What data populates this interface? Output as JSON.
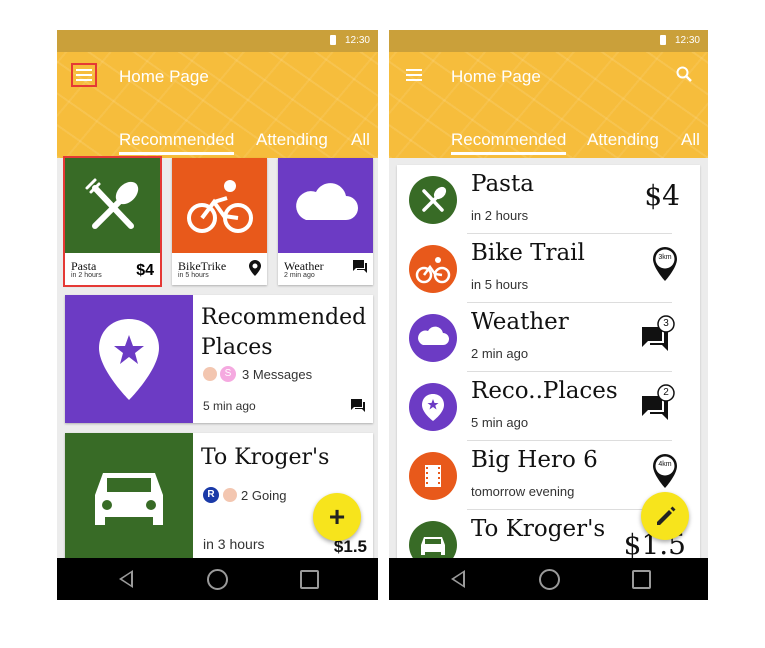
{
  "colors": {
    "appbar": "#f6bd3c",
    "green": "#386b26",
    "orange": "#e8591b",
    "purple": "#6c3bc4",
    "fab": "#f7e41c",
    "highlight": "#e53935"
  },
  "left": {
    "time": "12:30",
    "title": "Home Page",
    "tabs": [
      "Recommended",
      "Attending",
      "All"
    ],
    "cards": [
      {
        "title": "Pasta",
        "sub": "in 2 hours",
        "right": "$4",
        "icon": "fork-spoon-icon"
      },
      {
        "title": "BikeTrike",
        "sub": "in 5 hours",
        "icon": "bike-icon"
      },
      {
        "title": "Weather",
        "sub": "2 min ago",
        "icon": "cloud-icon"
      }
    ],
    "recommended": {
      "title_l1": "Recommended",
      "title_l2": "Places",
      "avatar_letter": "S",
      "messages": "3 Messages",
      "time": "5 min ago"
    },
    "kroger": {
      "title": "To Kroger's",
      "avatar_letter": "R",
      "going": "2 Going",
      "time": "in 3 hours",
      "price": "$1.5"
    },
    "fab_label": "+"
  },
  "right": {
    "time": "12:30",
    "title": "Home Page",
    "tabs": [
      "Recommended",
      "Attending",
      "All"
    ],
    "rows": [
      {
        "title": "Pasta",
        "sub": "in 2 hours",
        "right": "$4"
      },
      {
        "title": "Bike Trail",
        "sub": "in 5 hours",
        "right": "3km"
      },
      {
        "title": "Weather",
        "sub": "2 min ago",
        "right": "3"
      },
      {
        "title": "Reco..Places",
        "sub": "5 min ago",
        "right": "2"
      },
      {
        "title": "Big Hero 6",
        "sub": "tomorrow evening",
        "right": "4km"
      },
      {
        "title": "To Kroger's",
        "sub": "",
        "right": "$1.5"
      }
    ]
  }
}
